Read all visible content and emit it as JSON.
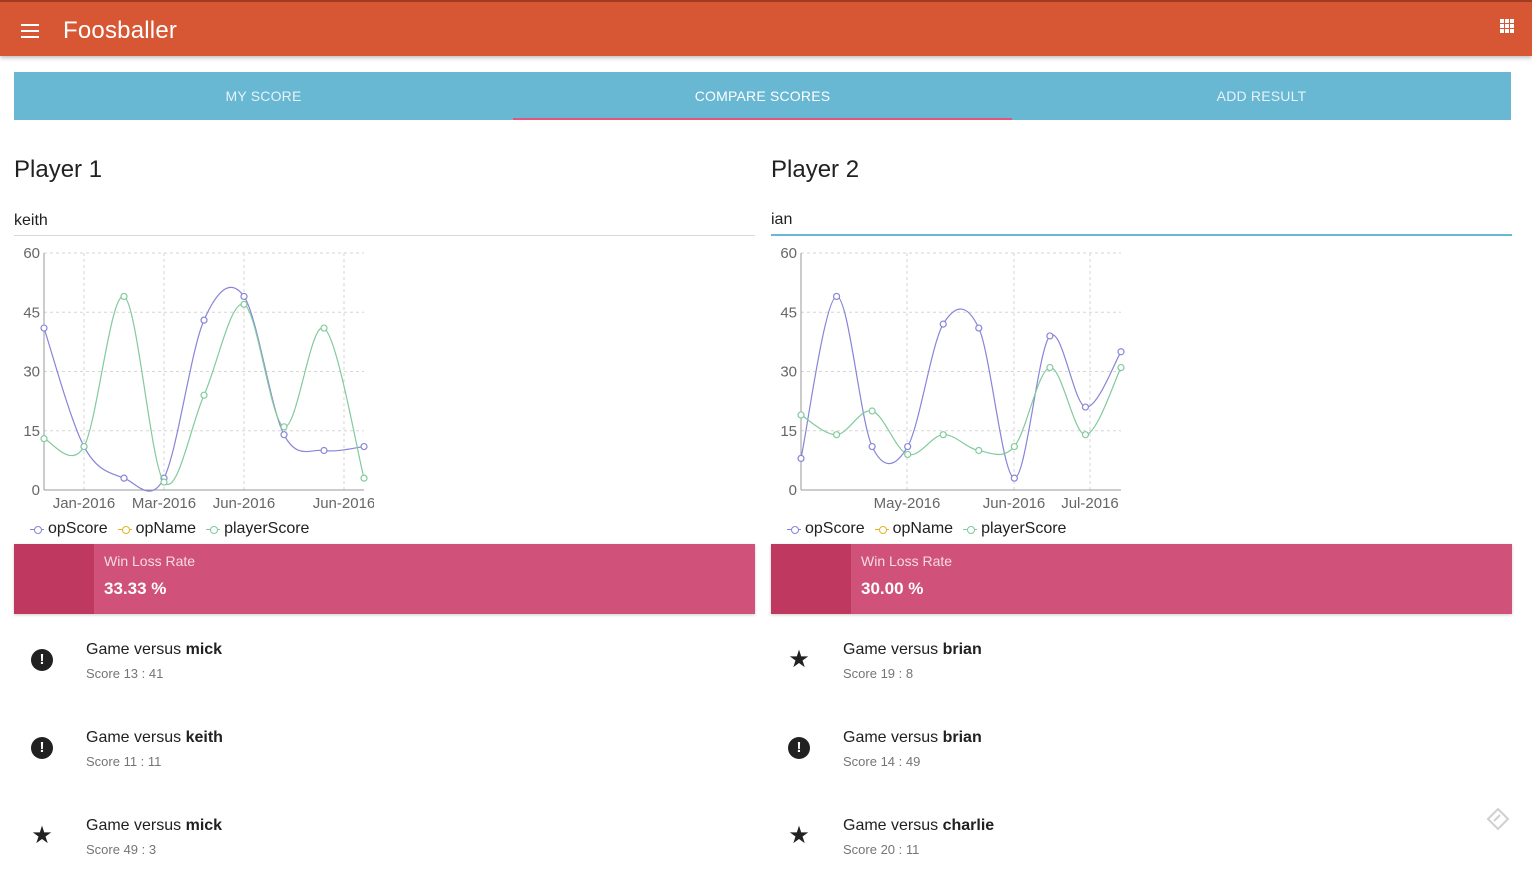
{
  "app": {
    "title": "Foosballer"
  },
  "tabs": [
    {
      "label": "MY SCORE",
      "active": false
    },
    {
      "label": "COMPARE SCORES",
      "active": true
    },
    {
      "label": "ADD RESULT",
      "active": false
    }
  ],
  "colors": {
    "appbar": "#d75634",
    "tabs": "#68b7d3",
    "tab_indicator": "#e0577d",
    "rate_card": "#d0517a",
    "opScore": "#8884d8",
    "opName": "#e6b422",
    "playerScore": "#82ca9d"
  },
  "players": [
    {
      "title": "Player 1",
      "input_value": "keith",
      "legend": [
        "opScore",
        "opName",
        "playerScore"
      ],
      "rate_label": "Win Loss Rate",
      "rate_value": "33.33 %",
      "games": [
        {
          "icon": "alert-icon",
          "prefix": "Game versus ",
          "opponent": "mick",
          "score": "Score 13 : 41"
        },
        {
          "icon": "alert-icon",
          "prefix": "Game versus ",
          "opponent": "keith",
          "score": "Score 11 : 11"
        },
        {
          "icon": "star-icon",
          "prefix": "Game versus ",
          "opponent": "mick",
          "score": "Score 49 : 3"
        }
      ]
    },
    {
      "title": "Player 2",
      "input_value": "ian",
      "legend": [
        "opScore",
        "opName",
        "playerScore"
      ],
      "rate_label": "Win Loss Rate",
      "rate_value": "30.00 %",
      "games": [
        {
          "icon": "star-icon",
          "prefix": "Game versus ",
          "opponent": "brian",
          "score": "Score 19 : 8"
        },
        {
          "icon": "alert-icon",
          "prefix": "Game versus ",
          "opponent": "brian",
          "score": "Score 14 : 49"
        },
        {
          "icon": "star-icon",
          "prefix": "Game versus ",
          "opponent": "charlie",
          "score": "Score 20 : 11"
        }
      ]
    }
  ],
  "chart_data": [
    {
      "type": "line",
      "ylim": [
        0,
        60
      ],
      "yticks": [
        0,
        15,
        30,
        45,
        60
      ],
      "xticks": [
        "Jan-2016",
        "Mar-2016",
        "Jun-2016",
        "Jun-2016"
      ],
      "legend_position": "bottom-left",
      "grid": true,
      "series": [
        {
          "name": "opScore",
          "values": [
            41,
            11,
            3,
            3,
            43,
            49,
            14,
            10,
            11
          ]
        },
        {
          "name": "opName",
          "values": []
        },
        {
          "name": "playerScore",
          "values": [
            13,
            11,
            49,
            2,
            24,
            47,
            16,
            41,
            3
          ]
        }
      ]
    },
    {
      "type": "line",
      "ylim": [
        0,
        60
      ],
      "yticks": [
        0,
        15,
        30,
        45,
        60
      ],
      "xticks": [
        "May-2016",
        "Jun-2016",
        "Jul-2016"
      ],
      "legend_position": "bottom-left",
      "grid": true,
      "series": [
        {
          "name": "opScore",
          "values": [
            8,
            49,
            11,
            11,
            42,
            41,
            3,
            39,
            21,
            35
          ]
        },
        {
          "name": "opName",
          "values": []
        },
        {
          "name": "playerScore",
          "values": [
            19,
            14,
            20,
            9,
            14,
            10,
            11,
            31,
            14,
            31
          ]
        }
      ]
    }
  ]
}
